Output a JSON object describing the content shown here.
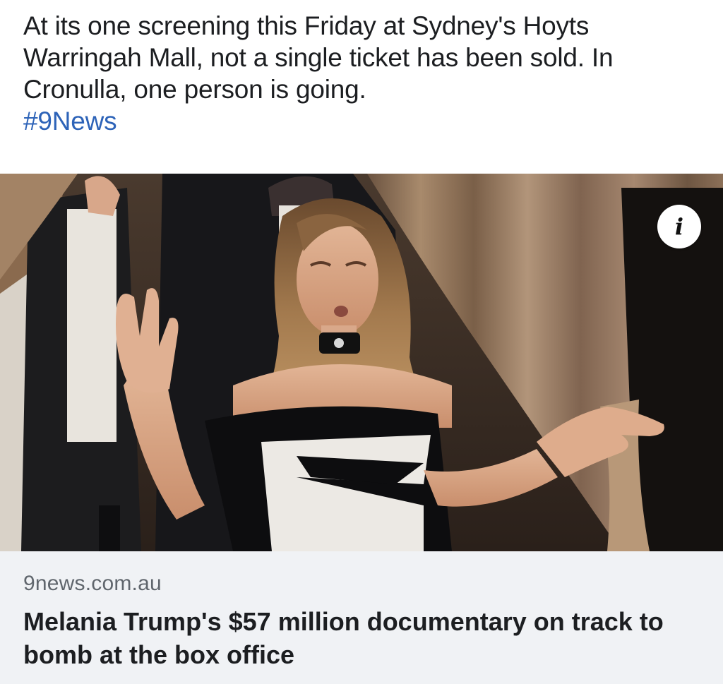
{
  "post": {
    "text": "At its one screening this Friday at Sydney's Hoyts Warringah Mall, not a single ticket has been sold. In Cronulla, one person is going.",
    "hashtag": "#9News"
  },
  "link_card": {
    "info_icon": "info-icon",
    "info_glyph": "i",
    "domain": "9news.com.au",
    "title": "Melania Trump's $57 million documentary on track to bomb at the box office"
  },
  "colors": {
    "hashtag": "#2d63b8",
    "card_background": "#f0f2f5",
    "domain_text": "#60666d",
    "text": "#1c1e21"
  }
}
